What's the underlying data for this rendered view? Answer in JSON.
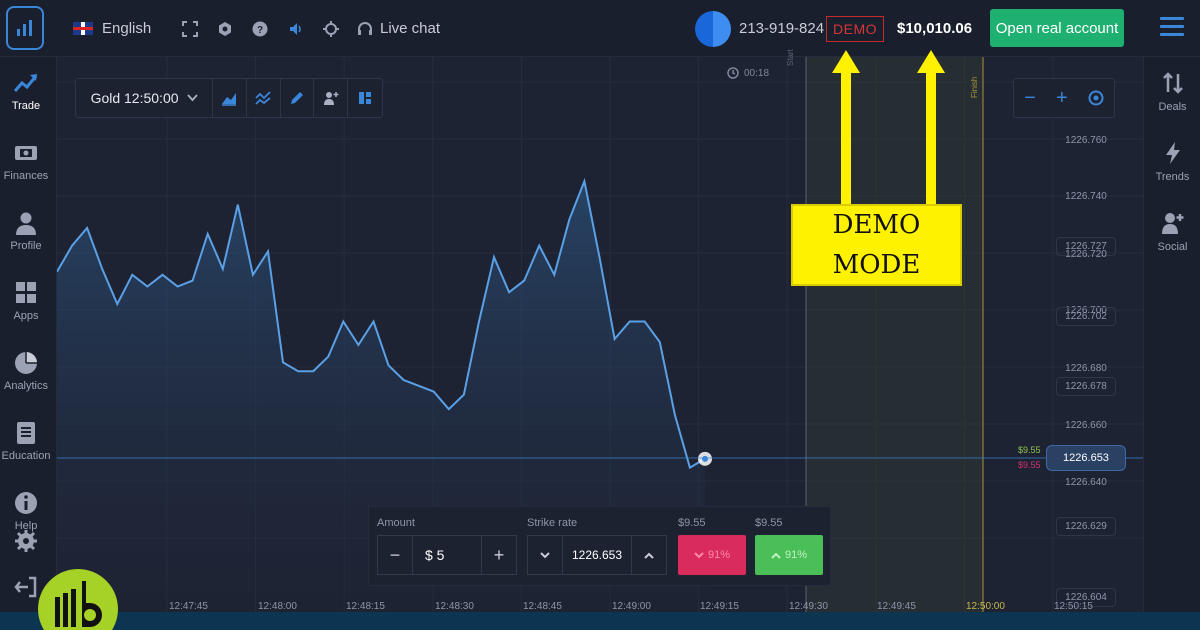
{
  "header": {
    "language": "English",
    "live_chat": "Live chat",
    "account_id": "213-919-824",
    "mode_badge": "DEMO",
    "balance": "$10,010.06",
    "open_real_account": "Open real account"
  },
  "left_nav": [
    {
      "label": "Trade",
      "icon": "trend-up-icon"
    },
    {
      "label": "Finances",
      "icon": "banknote-icon"
    },
    {
      "label": "Profile",
      "icon": "user-icon"
    },
    {
      "label": "Apps",
      "icon": "grid-icon"
    },
    {
      "label": "Analytics",
      "icon": "pie-chart-icon"
    },
    {
      "label": "Education",
      "icon": "book-icon"
    },
    {
      "label": "Help",
      "icon": "info-icon"
    }
  ],
  "right_nav": [
    {
      "label": "Deals",
      "icon": "swap-arrows-icon"
    },
    {
      "label": "Trends",
      "icon": "lightning-icon"
    },
    {
      "label": "Social",
      "icon": "user-plus-icon"
    }
  ],
  "toolbar": {
    "asset": "Gold 12:50:00"
  },
  "chart": {
    "timer": "00:18",
    "start_label": "Start",
    "finish_label": "Finish",
    "price_labels": [
      "1226.760",
      "1226.740",
      "1226.727",
      "1226.720",
      "1226.700",
      "1226.702",
      "1226.680",
      "1226.678",
      "1226.660",
      "1226.640",
      "1226.629",
      "1226.604"
    ],
    "current_price": "1226.653",
    "payout_up": "$9.55",
    "payout_down": "$9.55",
    "time_labels": [
      "12:47:45",
      "12:48:00",
      "12:48:15",
      "12:48:30",
      "12:48:45",
      "12:49:00",
      "12:49:15",
      "12:49:30",
      "12:49:45",
      "12:50:00",
      "12:50:15"
    ]
  },
  "chart_data": {
    "type": "area",
    "title": "",
    "xlabel": "",
    "ylabel": "",
    "ylim": [
      1226.604,
      1226.77
    ],
    "x_ticks": [
      "12:47:45",
      "12:48:00",
      "12:48:15",
      "12:48:30",
      "12:48:45",
      "12:49:00",
      "12:49:15",
      "12:49:30",
      "12:49:45",
      "12:50:00",
      "12:50:15"
    ],
    "series": [
      {
        "values": [
          1226.717,
          1226.726,
          1226.732,
          1226.718,
          1226.706,
          1226.716,
          1226.712,
          1226.716,
          1226.712,
          1226.714,
          1226.73,
          1226.718,
          1226.74,
          1226.716,
          1226.724,
          1226.686,
          1226.683,
          1226.683,
          1226.688,
          1226.7,
          1226.692,
          1226.7,
          1226.685,
          1226.68,
          1226.678,
          1226.676,
          1226.67,
          1226.675,
          1226.7,
          1226.722,
          1226.71,
          1226.714,
          1226.726,
          1226.716,
          1226.735,
          1226.748,
          1226.722,
          1226.694,
          1226.7,
          1226.7,
          1226.693,
          1226.668,
          1226.65,
          1226.653
        ]
      }
    ]
  },
  "trade_panel": {
    "amount_label": "Amount",
    "amount_value": "$ 5",
    "strike_label": "Strike rate",
    "strike_value": "1226.653",
    "down_payout": "$9.55",
    "up_payout": "$9.55",
    "down_percent": "91%",
    "up_percent": "91%"
  },
  "annotation": {
    "line1": "DEMO",
    "line2": "MODE"
  },
  "colors": {
    "accent": "#3a86d8",
    "green": "#1eb070",
    "red": "#d92c5c",
    "annotation_yellow": "#fff200"
  }
}
